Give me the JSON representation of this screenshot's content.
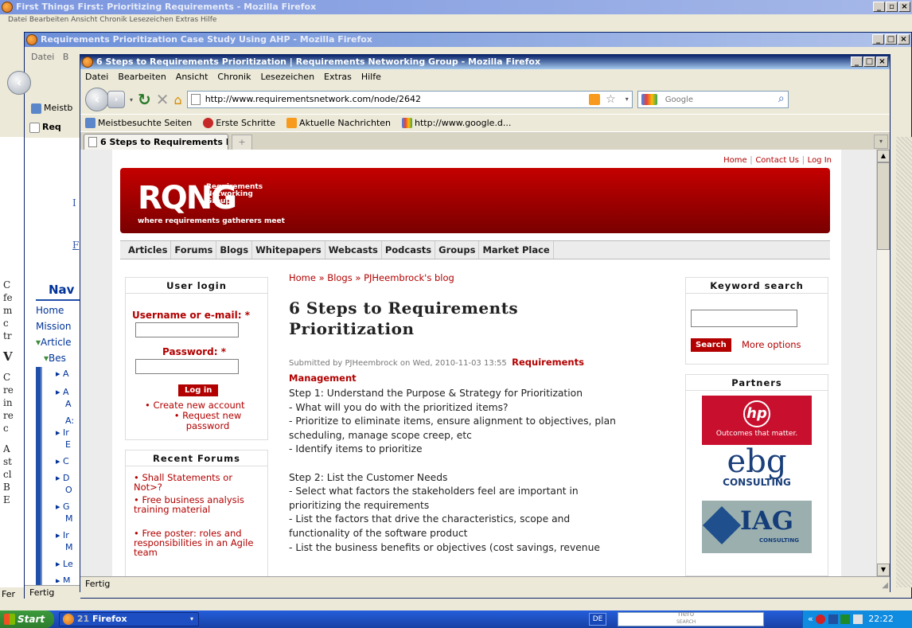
{
  "win_back": {
    "title": "First Things First: Prioritizing Requirements - Mozilla Firefox",
    "menu_partial": "Datei Bearbeiten Ansicht Chronik Lesezeichen Extras Hilfe",
    "status": "Fertig",
    "status_prefix": "Fer"
  },
  "win_mid": {
    "title": "Requirements Prioritization Case Study Using AHP - Mozilla Firefox",
    "menu": [
      "Datei",
      "B"
    ],
    "bookmark_partial": "Meistb",
    "tab_partial": "Req",
    "status": "Fertig"
  },
  "win_front": {
    "title": "6 Steps to Requirements Prioritization | Requirements Networking Group - Mozilla Firefox",
    "menu": [
      "Datei",
      "Bearbeiten",
      "Ansicht",
      "Chronik",
      "Lesezeichen",
      "Extras",
      "Hilfe"
    ],
    "url": "http://www.requirementsnetwork.com/node/2642",
    "search_placeholder": "Google",
    "bookmarks": [
      "Meistbesuchte Seiten",
      "Erste Schritte",
      "Aktuelle Nachrichten",
      "http://www.google.d..."
    ],
    "tab_title": "6 Steps to Requirements Prioritizati...",
    "tab_new": "+",
    "status": "Fertig"
  },
  "page": {
    "topnav": [
      "Home",
      "Contact Us",
      "Log In"
    ],
    "logo": {
      "letters": "RQNG",
      "line1": "Requirements",
      "line2": "Networking",
      "line3": "Group",
      "tagline": "where requirements gatherers meet"
    },
    "menu": [
      "Articles",
      "Forums",
      "Blogs",
      "Whitepapers",
      "Webcasts",
      "Podcasts",
      "Groups",
      "Market Place"
    ],
    "login": {
      "title": "User login",
      "username_label": "Username or e-mail:",
      "star": "*",
      "password_label": "Password:",
      "button": "Log in",
      "links": [
        "Create new account",
        "Request new password"
      ]
    },
    "forums": {
      "title": "Recent Forums",
      "items": [
        "Shall Statements or Not>?",
        "Free business analysis training material",
        "Free poster: roles and responsibilities in an Agile team"
      ]
    },
    "breadcrumb": "Home » Blogs » PJHeembrock's blog",
    "article": {
      "title": "6 Steps to Requirements Prioritization",
      "submitted": "Submitted by PJHeembrock on Wed, 2010-11-03 13:55",
      "category": "Requirements Management",
      "lines": [
        "Step 1: Understand the Purpose & Strategy for Prioritization",
        "- What will you do with the prioritized items?",
        "- Prioritize to eliminate items, ensure alignment to objectives, plan",
        "scheduling, manage scope creep, etc",
        "- Identify items to prioritize",
        "",
        "Step 2: List the Customer Needs",
        "- Select what factors the stakeholders feel are important in",
        "prioritizing the requirements",
        "- List the factors that drive the characteristics, scope and",
        "functionality of the software product",
        "- List the business benefits or objectives (cost savings, revenue"
      ]
    },
    "keyword": {
      "title": "Keyword search",
      "button": "Search",
      "more": "More options"
    },
    "partners": {
      "title": "Partners",
      "hp": "hp",
      "hp_tag": "Outcomes that matter.",
      "ebg": "ebg",
      "ebg_sub": "CONSULTING",
      "iag": "IAG",
      "iag_sub": "CONSULTING"
    }
  },
  "left_page": {
    "nav_title": "Nav",
    "links": [
      "Home",
      "Mission",
      "Article",
      "Bes"
    ],
    "initials": [
      "I",
      "F"
    ],
    "text_frag": [
      "C",
      "fe",
      "m",
      "c",
      "tr",
      "V",
      "C",
      "re",
      "in",
      "re",
      "c",
      "A",
      "st",
      "cl",
      "B",
      "E"
    ],
    "sub_frag": [
      "A",
      "A",
      "A",
      "A:",
      "Ir",
      "E",
      "C",
      "D",
      "O",
      "G",
      "M",
      "Ir",
      "M",
      "Le",
      "M"
    ]
  },
  "taskbar": {
    "start": "Start",
    "count": "21",
    "app": "Firefox",
    "lang": "DE",
    "search_brand": "nero",
    "search_sub": "SEARCH",
    "clock": "22:22"
  }
}
